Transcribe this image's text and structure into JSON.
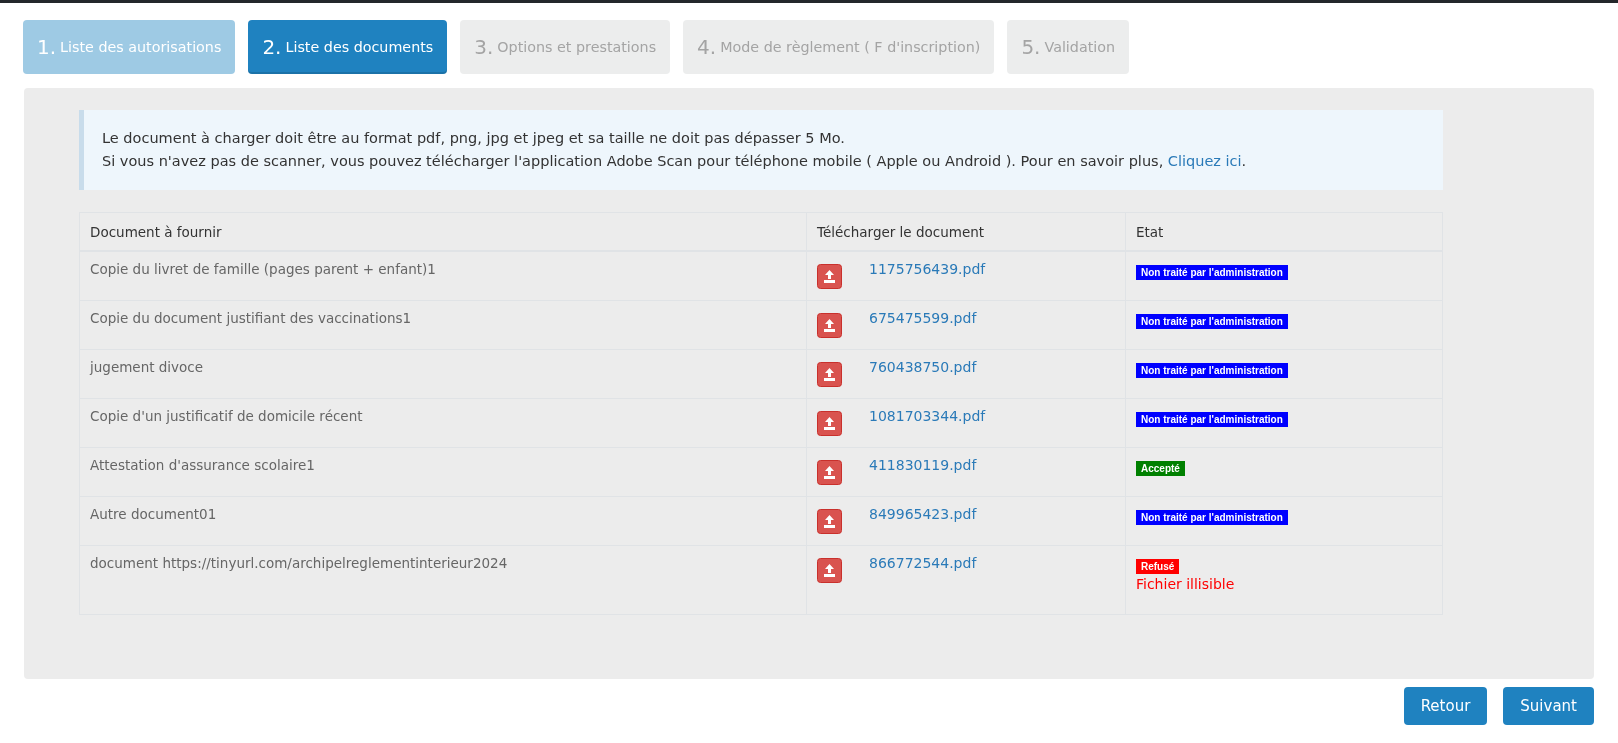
{
  "steps": [
    {
      "number": "1.",
      "label": "Liste des autorisations",
      "kind": "done",
      "selected": false
    },
    {
      "number": "2.",
      "label": "Liste des documents",
      "kind": "current",
      "selected": true
    },
    {
      "number": "3.",
      "label": "Options et prestations",
      "kind": "pending",
      "selected": false
    },
    {
      "number": "4.",
      "label": "Mode de règlement ( F d'inscription)",
      "kind": "pending",
      "selected": false
    },
    {
      "number": "5.",
      "label": "Validation",
      "kind": "pending",
      "selected": false
    }
  ],
  "info": {
    "line_1": "Le document à charger doit être au format pdf, png, jpg et jpeg et sa taille ne doit pas dépasser 5 Mo.",
    "line_2": "Si vous n'avez pas de scanner, vous pouvez télécharger l'application Adobe Scan pour téléphone mobile ( Apple ou Android ). Pour en savoir plus, ",
    "link": "Cliquez ici",
    "line_2_end": "."
  },
  "table": {
    "columns": [
      "Document à fournir",
      "Télécharger le document",
      "Etat"
    ],
    "rows": [
      {
        "document": "Copie du livret de famille (pages parent + enfant)1",
        "file": "1175756439.pdf",
        "status": "Non traité par l'administration",
        "color": "#0000ff"
      },
      {
        "document": "Copie du document justifiant des vaccinations1",
        "file": "675475599.pdf",
        "status": "Non traité par l'administration",
        "color": "#0000ff"
      },
      {
        "document": "jugement divoce",
        "file": "760438750.pdf",
        "status": "Non traité par l'administration",
        "color": "#0000ff"
      },
      {
        "document": "Copie d'un justificatif de domicile récent",
        "file": "1081703344.pdf",
        "status": "Non traité par l'administration",
        "color": "#0000ff"
      },
      {
        "document": "Attestation d'assurance scolaire1",
        "file": "411830119.pdf",
        "status": "Accepté",
        "color": "#008000"
      },
      {
        "document": "Autre document01",
        "file": "849965423.pdf",
        "status": "Non traité par l'administration",
        "color": "#0000ff"
      },
      {
        "document": "document https://tinyurl.com/archipelreglementinterieur2024",
        "file": "866772544.pdf",
        "status": "Refusé",
        "color": "#ff0000",
        "note": "Fichier illisible"
      }
    ]
  },
  "buttons": [
    "Retour",
    "Suivant"
  ]
}
